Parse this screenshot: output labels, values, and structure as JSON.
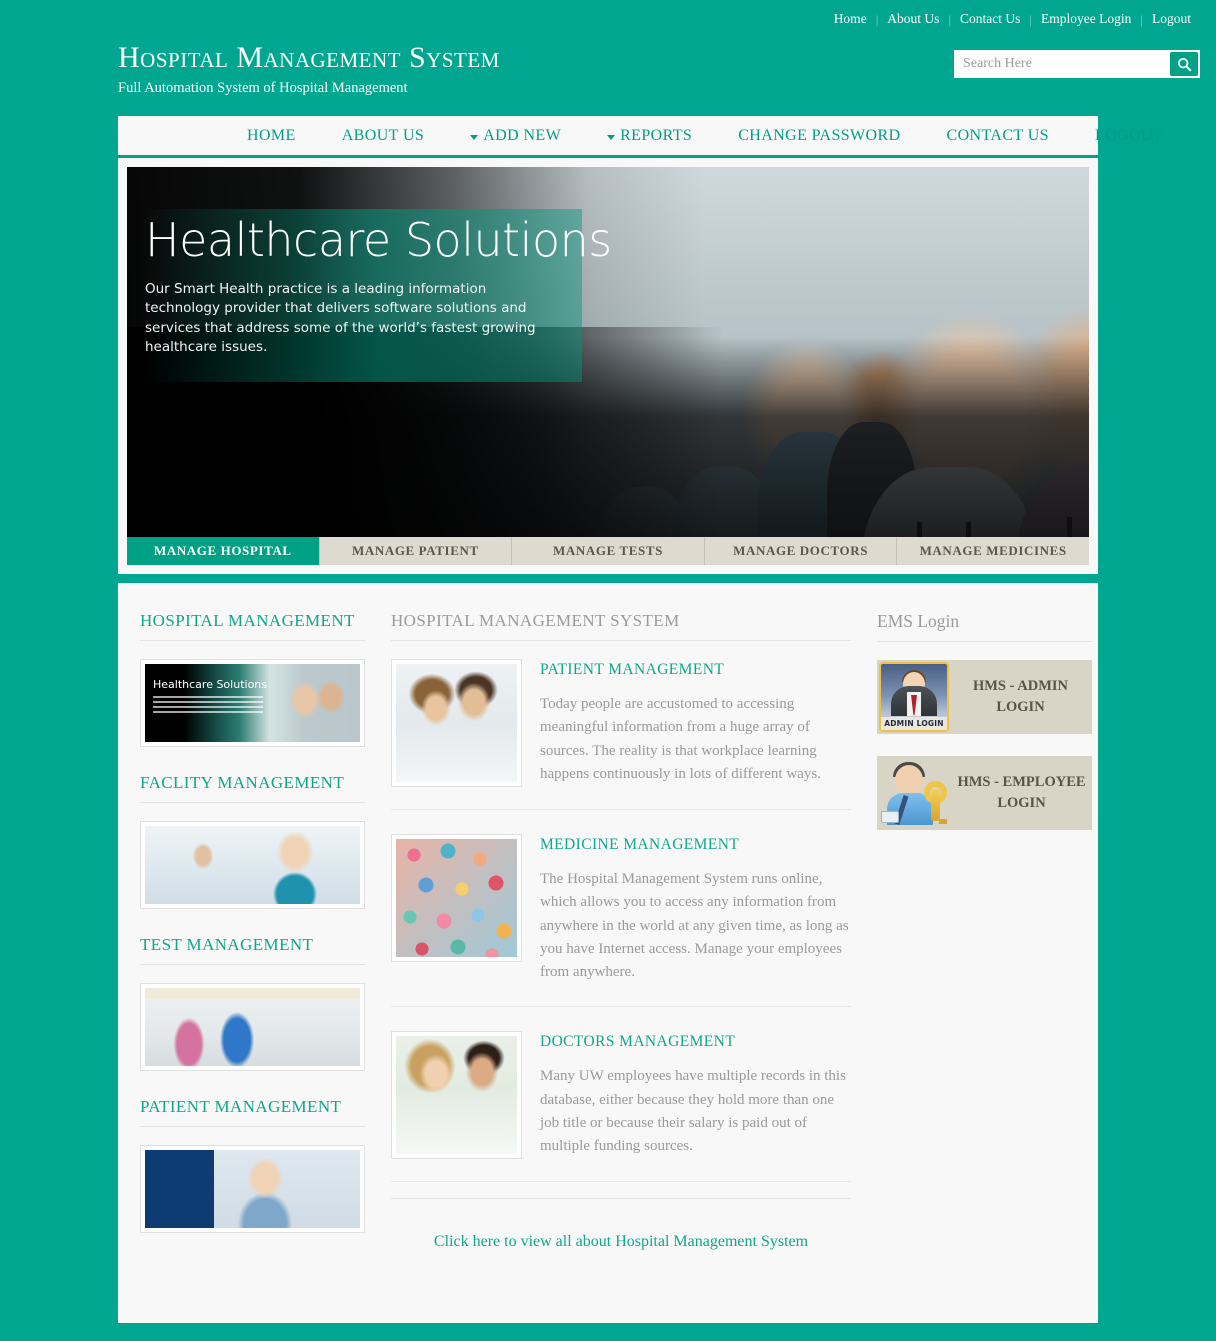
{
  "topnav": {
    "items": [
      {
        "label": "Home"
      },
      {
        "label": "About Us"
      },
      {
        "label": "Contact Us"
      },
      {
        "label": "Employee Login"
      },
      {
        "label": "Logout"
      }
    ],
    "separator": "|"
  },
  "brand": {
    "title": "Hospital Management System",
    "tagline": "Full Automation System of Hospital Management"
  },
  "search": {
    "placeholder": "Search Here",
    "value": "",
    "icon": "search-icon"
  },
  "mainmenu": {
    "items": [
      {
        "label": "HOME",
        "dropdown": false
      },
      {
        "label": "ABOUT US",
        "dropdown": false
      },
      {
        "label": "ADD NEW",
        "dropdown": true
      },
      {
        "label": "REPORTS",
        "dropdown": true
      },
      {
        "label": "CHANGE PASSWORD",
        "dropdown": false
      },
      {
        "label": "CONTACT US",
        "dropdown": false
      },
      {
        "label": "LOGOUT",
        "dropdown": false
      }
    ]
  },
  "hero": {
    "title": "Healthcare Solutions",
    "subtitle": "Our Smart Health practice is a leading information technology provider that delivers software solutions and services that address some of the world’s fastest growing healthcare issues."
  },
  "tabs": [
    {
      "label": "MANAGE HOSPITAL",
      "active": true
    },
    {
      "label": "MANAGE PATIENT",
      "active": false
    },
    {
      "label": "MANAGE TESTS",
      "active": false
    },
    {
      "label": "MANAGE DOCTORS",
      "active": false
    },
    {
      "label": "MANAGE MEDICINES",
      "active": false
    }
  ],
  "sidebar": {
    "sections": [
      {
        "title": "HOSPITAL MANAGEMENT",
        "image": "healthcare-solutions-banner-thumbnail"
      },
      {
        "title": "FACLITY MANAGEMENT",
        "image": "nurse-with-patient-thumbnail"
      },
      {
        "title": "TEST MANAGEMENT",
        "image": "operating-theatre-thumbnail"
      },
      {
        "title": "PATIENT MANAGEMENT",
        "image": "nurse-treating-patient-thumbnail"
      }
    ]
  },
  "main": {
    "heading": "HOSPITAL MANAGEMENT SYSTEM",
    "articles": [
      {
        "title": "PATIENT MANAGEMENT",
        "text": "Today people are accustomed to accessing meaningful information from a huge array of sources. The reality is that workplace learning happens continuously in lots of different ways.",
        "image": "doctor-with-patient-photo"
      },
      {
        "title": "MEDICINE MANAGEMENT",
        "text": "The Hospital Management System runs online, which allows you to access any information from anywhere in the world at any given time, as long as you have Internet access. Manage your employees from anywhere.",
        "image": "colorful-pills-photo"
      },
      {
        "title": "DOCTORS MANAGEMENT",
        "text": "Many UW employees have multiple records in this database, either because they hold more than one job title or because their salary is paid out of multiple funding sources.",
        "image": "two-doctors-photo"
      }
    ],
    "more_link": "Click here to view all about Hospital Management System"
  },
  "rightpanel": {
    "heading": "EMS Login",
    "cards": [
      {
        "label": "HMS - ADMIN LOGIN",
        "icon": "admin-login-icon",
        "icon_caption": "ADMIN LOGIN"
      },
      {
        "label": "HMS - EMPLOYEE LOGIN",
        "icon": "employee-key-icon"
      }
    ]
  },
  "colors": {
    "brand_teal": "#00a690",
    "tab_active": "#00a184",
    "tab_inactive": "#dedad0",
    "heading_teal": "#0fa68e",
    "card_beige": "#d8d4c6",
    "body_bg": "#f8f8f8"
  }
}
